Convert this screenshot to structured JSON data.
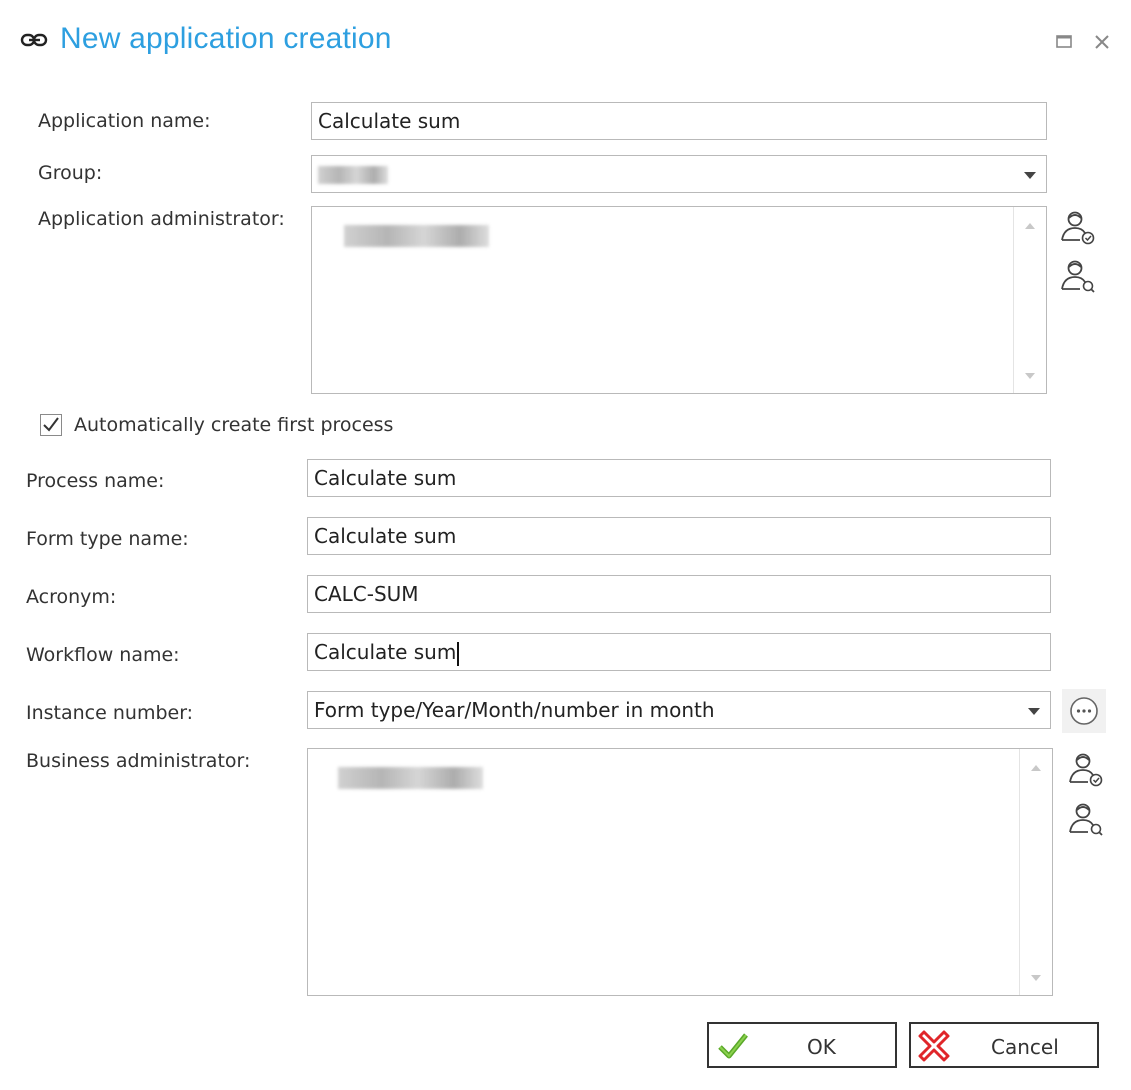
{
  "window": {
    "title": "New application creation",
    "title_icon": "link-icon",
    "maximize_icon": "maximize-icon",
    "close_icon": "close-icon",
    "accent_color": "#2d9fe0"
  },
  "form": {
    "application_name": {
      "label": "Application name:",
      "value": "Calculate sum"
    },
    "group": {
      "label": "Group:",
      "value": ""
    },
    "application_administrator": {
      "label": "Application administrator:"
    },
    "auto_create": {
      "label": "Automatically create first process",
      "checked": true
    },
    "process_name": {
      "label": "Process name:",
      "value": "Calculate sum"
    },
    "form_type_name": {
      "label": "Form type name:",
      "value": "Calculate sum"
    },
    "acronym": {
      "label": "Acronym:",
      "value": "CALC-SUM"
    },
    "workflow_name": {
      "label": "Workflow name:",
      "value": "Calculate sum"
    },
    "instance_number": {
      "label": "Instance number:",
      "value": "Form type/Year/Month/number in month"
    },
    "business_administrator": {
      "label": "Business administrator:"
    }
  },
  "buttons": {
    "ok": "OK",
    "cancel": "Cancel",
    "ok_icon": "check-icon",
    "cancel_icon": "cross-icon",
    "ok_icon_color": "#5aa829",
    "cancel_icon_color": "#e0262a"
  }
}
